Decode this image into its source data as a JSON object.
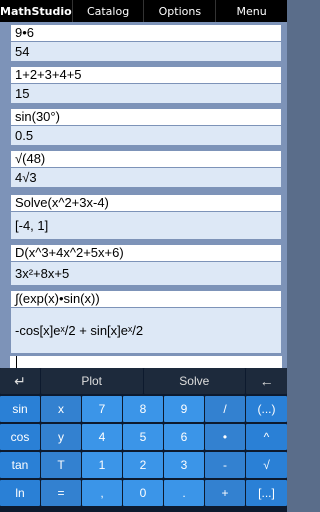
{
  "topbar": {
    "tabs": [
      "MathStudio",
      "Catalog",
      "Options",
      "Menu"
    ]
  },
  "entries": [
    {
      "input": "9•6",
      "output": "54"
    },
    {
      "input": "1+2+3+4+5",
      "output": "15"
    },
    {
      "input": "sin(30°)",
      "output": "0.5"
    },
    {
      "input": "√(48)",
      "output": "4√3"
    },
    {
      "input": "Solve(x^2+3x-4)",
      "output": "[-4, 1]"
    },
    {
      "input": "D(x^3+4x^2+5x+6)",
      "output": "3x²+8x+5"
    },
    {
      "input": "∫(exp(x)•sin(x))",
      "output": "-cos[x]eˣ/2 + sin[x]eˣ/2"
    }
  ],
  "keypad": {
    "row1": [
      "↵",
      "Plot",
      "Solve",
      "←"
    ],
    "row2": [
      "sin",
      "x",
      "7",
      "8",
      "9",
      "/",
      "(...)"
    ],
    "row3": [
      "cos",
      "y",
      "4",
      "5",
      "6",
      "•",
      "^"
    ],
    "row4": [
      "tan",
      "T",
      "1",
      "2",
      "3",
      "-",
      "√"
    ],
    "row5": [
      "ln",
      "=",
      ",",
      "0",
      ".",
      "+",
      "[...]"
    ]
  }
}
